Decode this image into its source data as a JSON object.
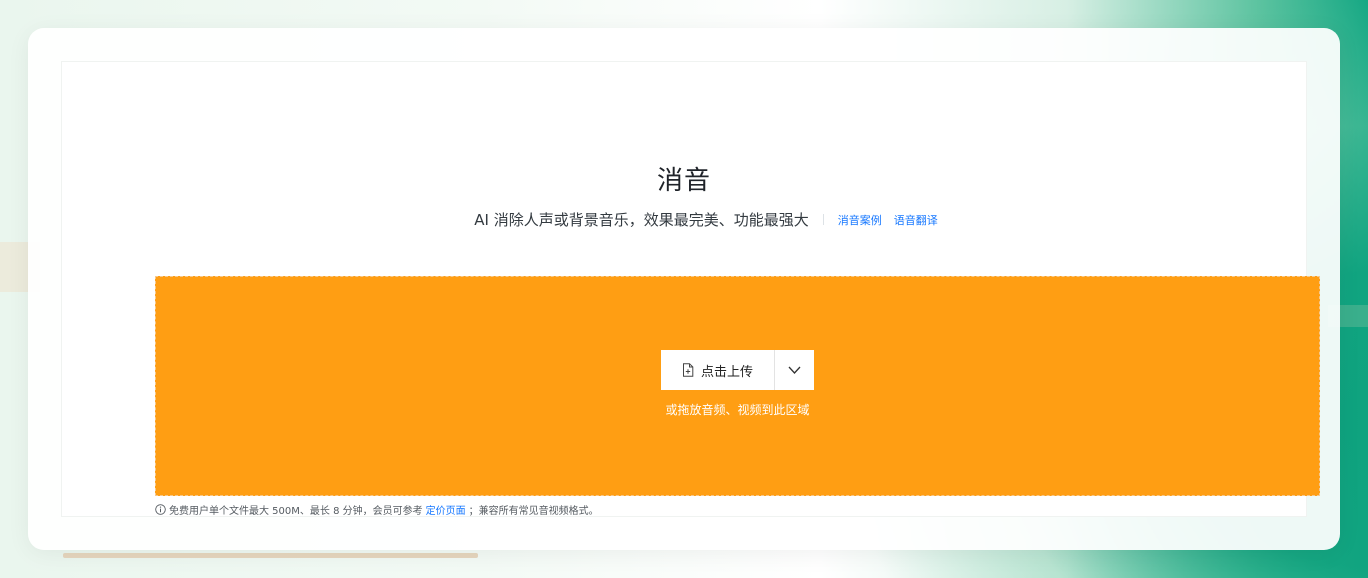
{
  "header": {
    "title": "消音",
    "subtitle": "AI 消除人声或背景音乐，效果最完美、功能最强大",
    "links": [
      "消音案例",
      "语音翻译"
    ]
  },
  "upload": {
    "button_label": "点击上传",
    "drop_hint": "或拖放音频、视频到此区域",
    "icons": {
      "upload": "file-plus-icon",
      "dropdown": "chevron-down-icon"
    },
    "accent_color": "#ff9e13"
  },
  "note": {
    "prefix": "免费用户单个文件最大 500M、最长 8 分钟，会员可参考",
    "link": "定价页面",
    "suffix": "；兼容所有常见音视频格式。",
    "icon": "info-icon"
  }
}
